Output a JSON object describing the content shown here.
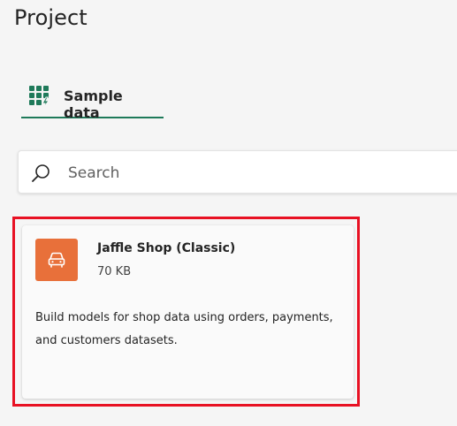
{
  "page": {
    "title": "Project"
  },
  "tabs": [
    {
      "label": "Sample data",
      "icon": "database-lightning-icon",
      "selected": true
    }
  ],
  "search": {
    "placeholder": "Search",
    "value": ""
  },
  "cards": [
    {
      "icon": "car-icon",
      "icon_color": "#e8703a",
      "title": "Jaffle Shop (Classic)",
      "size": "70 KB",
      "description": "Build models for shop data using orders, payments, and customers datasets."
    }
  ],
  "colors": {
    "accent": "#1f7a5a",
    "highlight": "#e81123"
  }
}
